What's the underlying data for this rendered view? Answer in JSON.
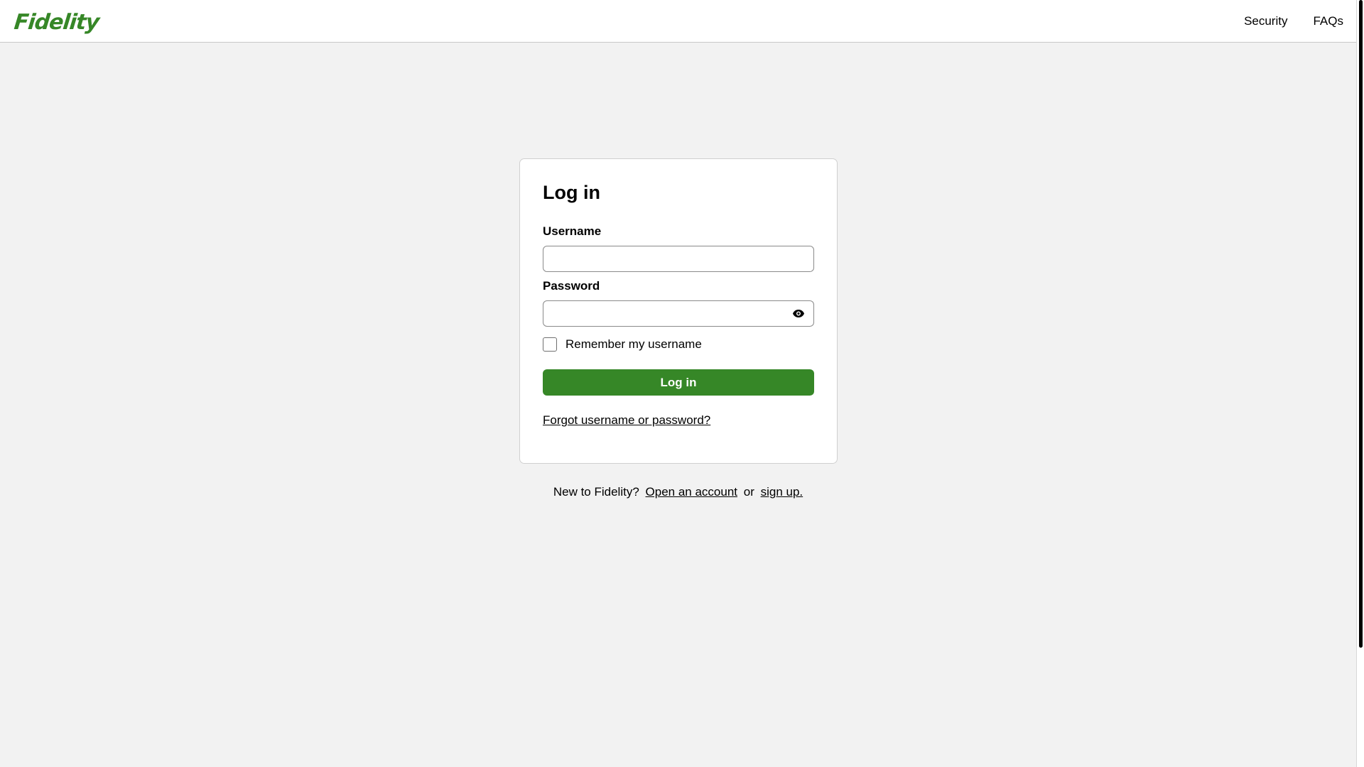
{
  "header": {
    "logo_text": "Fidelity",
    "nav": {
      "security": "Security",
      "faqs": "FAQs"
    }
  },
  "login_card": {
    "title": "Log in",
    "username": {
      "label": "Username",
      "value": "",
      "placeholder": ""
    },
    "password": {
      "label": "Password",
      "value": "",
      "placeholder": "",
      "toggle_icon": "eye-icon"
    },
    "remember": {
      "label": "Remember my username",
      "checked": false
    },
    "submit_label": "Log in",
    "forgot_link": "Forgot username or password?"
  },
  "footer": {
    "prefix": "New to Fidelity?",
    "open_account_link": "Open an account",
    "connector": "or",
    "sign_up_link": "sign up."
  },
  "colors": {
    "brand_green": "#368727",
    "page_background": "#f2f2f2"
  }
}
